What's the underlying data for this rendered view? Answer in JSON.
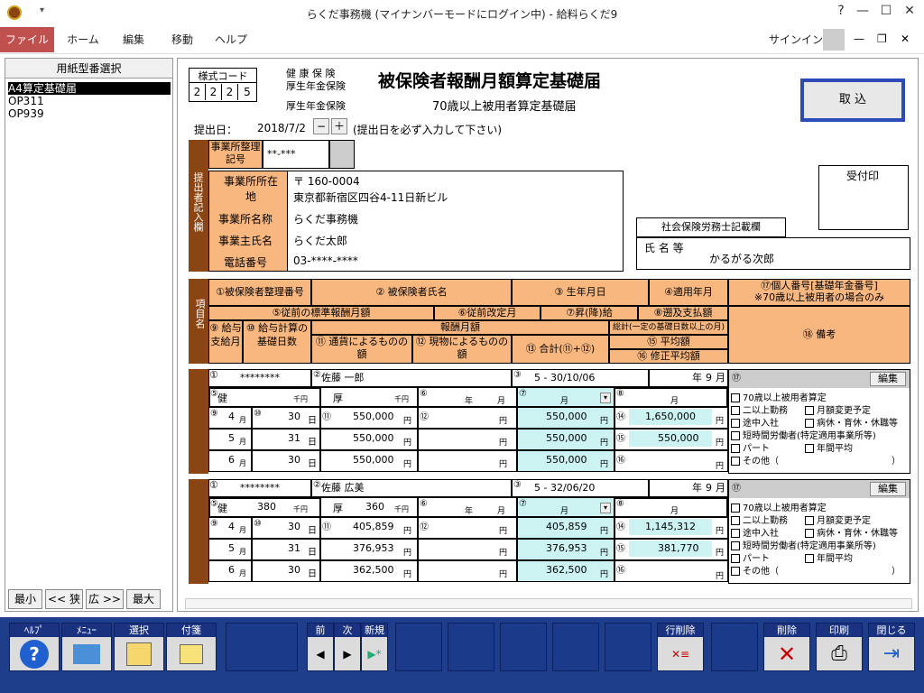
{
  "window": {
    "title": "らくだ事務機 (マイナンバーモードにログイン中) - 給料らくだ9",
    "help": "?",
    "minimize": "—",
    "maximize": "☐",
    "close": "✕"
  },
  "ribbon": {
    "tabs": [
      "ファイル",
      "ホーム",
      "編集",
      "移動",
      "ヘルプ"
    ],
    "signin": "サインイン"
  },
  "sidebar": {
    "header": "用紙型番選択",
    "items": [
      "A4算定基礎届",
      "OP311",
      "OP939"
    ],
    "buttons": [
      "最小",
      "<< 狭",
      "広 >>",
      "最大"
    ]
  },
  "form": {
    "style_code_label": "様式コード",
    "style_code": [
      "2",
      "2",
      "2",
      "5"
    ],
    "ins1": "健 康 保 険",
    "ins2": "厚生年金保険",
    "ins3": "厚生年金保険",
    "title": "被保険者報酬月額算定基礎届",
    "subtitle": "70歳以上被用者算定基礎届",
    "import_button": "取 込",
    "submit_label": "提出日：",
    "submit_date": "2018/7/2",
    "minus": "−",
    "plus": "＋",
    "submit_note": "(提出日を必ず入力して下さい)",
    "office_code_label": "事業所整理記号",
    "office_code": "**-***",
    "submitter_label": "提出者記入欄",
    "postal": "〒 160-0004",
    "address_label": "事業所所在地",
    "address": "東京都新宿区四谷4-11日新ビル",
    "office_name_label": "事業所名称",
    "office_name": "らくだ事務機",
    "owner_label": "事業主氏名",
    "owner": "らくだ太郎",
    "phone_label": "電話番号",
    "phone": "03-****-****",
    "received_label": "受付印",
    "sr_label": "社会保険労務士記載欄",
    "sr_name_label": "氏 名 等",
    "sr_name": "かるがる次郎"
  },
  "headers": {
    "side": "項目名",
    "h1": "①被保険者整理番号",
    "h2": "② 被保険者氏名",
    "h3": "③ 生年月日",
    "h4": "④適用年月",
    "h17": "⑰個人番号[基礎年金番号]",
    "h17b": "※70歳以上被用者の場合のみ",
    "h5": "⑤従前の標準報酬月額",
    "h6": "⑥従前改定月",
    "h7": "⑦昇(降)給",
    "h8": "⑧遡及支払額",
    "h9": "⑨ 給与 支給月",
    "h10": "⑩ 給与計算の 基礎日数",
    "hpay": "報酬月額",
    "h11": "⑪ 通貨によるものの額",
    "h12": "⑫ 現物によるものの額",
    "h13": "⑬ 合計(⑪+⑫)",
    "htotal": "総計(一定の基礎日数以上の月)",
    "h15": "⑮ 平均額",
    "h16": "⑯ 修正平均額",
    "h18": "⑱ 備考"
  },
  "records": [
    {
      "num": "********",
      "name": "佐藤 一郎",
      "birth": "5 - 30/10/06",
      "apply_year": "年",
      "apply_month": "9",
      "apply_m_unit": "月",
      "ins_type": "健",
      "prev_kenpo": "",
      "prev_kosei": "",
      "unit_sen": "千円",
      "kosei_label": "厚",
      "year_lbl": "年",
      "month_lbl": "月",
      "months": [
        {
          "m": "4",
          "days": "30",
          "amount": "550,000",
          "total": "550,000"
        },
        {
          "m": "5",
          "days": "31",
          "amount": "550,000",
          "total": "550,000"
        },
        {
          "m": "6",
          "days": "30",
          "amount": "550,000",
          "total": "550,000"
        }
      ],
      "sum": "1,650,000",
      "avg": "550,000",
      "edit": "編集",
      "remarks": [
        "70歳以上被用者算定",
        "二以上勤務",
        "月額変更予定",
        "途中入社",
        "病休・育休・休職等",
        "短時間労働者(特定適用事業所等)",
        "パート",
        "年間平均",
        "その他（"
      ]
    },
    {
      "num": "********",
      "name": "佐藤 広美",
      "birth": "5 - 32/06/20",
      "apply_year": "年",
      "apply_month": "9",
      "apply_m_unit": "月",
      "ins_type": "健",
      "prev_kenpo": "380",
      "prev_kosei": "360",
      "unit_sen": "千円",
      "kosei_label": "厚",
      "year_lbl": "年",
      "month_lbl": "月",
      "months": [
        {
          "m": "4",
          "days": "30",
          "amount": "405,859",
          "total": "405,859"
        },
        {
          "m": "5",
          "days": "31",
          "amount": "376,953",
          "total": "376,953"
        },
        {
          "m": "6",
          "days": "30",
          "amount": "362,500",
          "total": "362,500"
        }
      ],
      "sum": "1,145,312",
      "avg": "381,770",
      "edit": "編集",
      "remarks": [
        "70歳以上被用者算定",
        "二以上勤務",
        "月額変更予定",
        "途中入社",
        "病休・育休・休職等",
        "短時間労働者(特定適用事業所等)",
        "パート",
        "年間平均",
        "その他（"
      ]
    }
  ],
  "units": {
    "yen": "円",
    "day": "日",
    "month": "月",
    "close_paren": "）"
  },
  "circled": {
    "c1": "①",
    "c2": "②",
    "c3": "③",
    "c5": "⑤",
    "c6": "⑥",
    "c7": "⑦",
    "c8": "⑧",
    "c9": "⑨",
    "c10": "⑩",
    "c11": "⑪",
    "c12": "⑫",
    "c14": "⑭",
    "c15": "⑮",
    "c16": "⑯",
    "c17": "⑰"
  },
  "bottom": {
    "help": "ﾍﾙﾌﾟ",
    "menu": "ﾒﾆｭｰ",
    "select": "選択",
    "tag": "付箋",
    "prev": "前",
    "next": "次",
    "new": "新規",
    "delrow": "行削除",
    "delete": "削除",
    "print": "印刷",
    "close": "閉じる"
  }
}
